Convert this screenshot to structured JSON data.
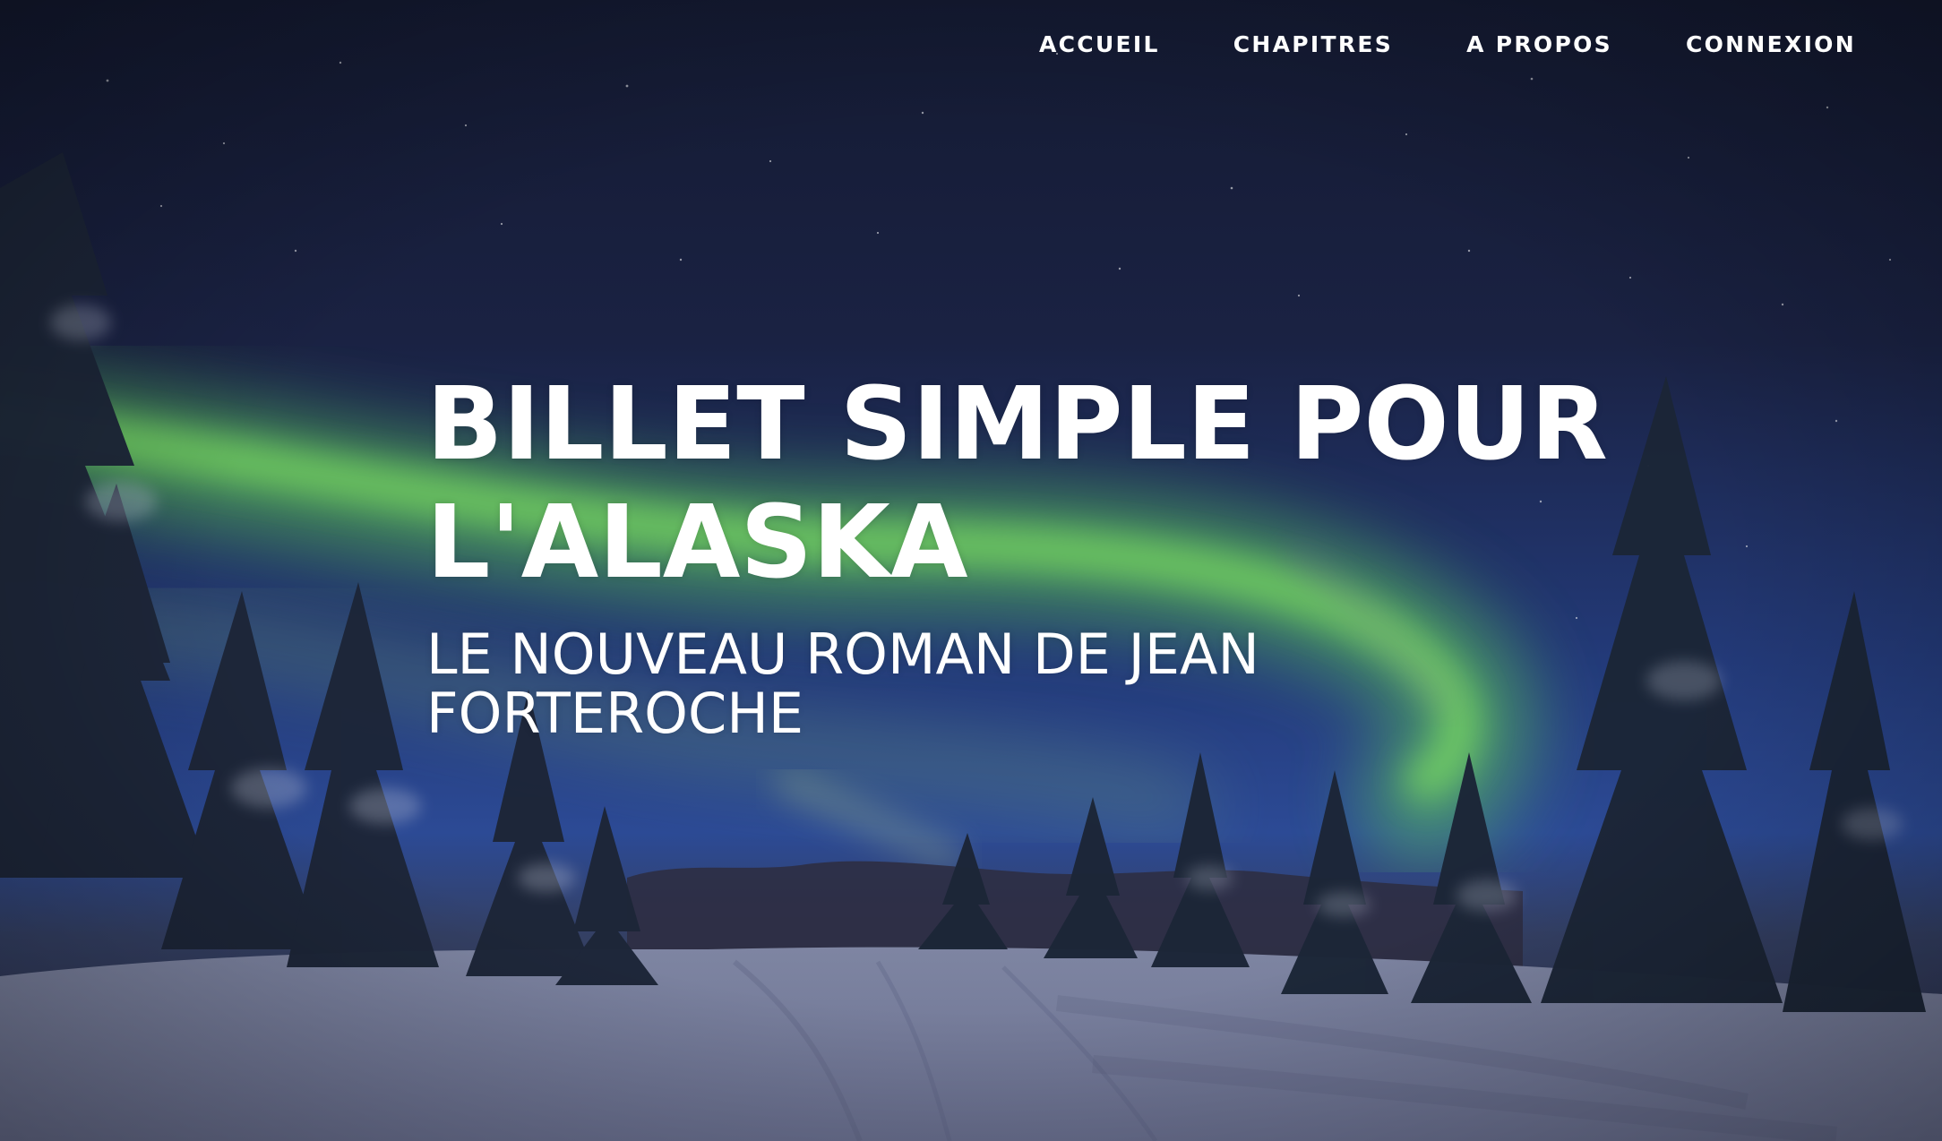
{
  "nav": {
    "items": [
      {
        "label": "ACCUEIL"
      },
      {
        "label": "CHAPITRES"
      },
      {
        "label": "A PROPOS"
      },
      {
        "label": "CONNEXION"
      }
    ]
  },
  "hero": {
    "title_lines": [
      "BILLET SIMPLE POUR",
      "L'ALASKA"
    ],
    "subtitle_lines": [
      "LE NOUVEAU ROMAN DE JEAN",
      "FORTEROCHE"
    ],
    "background_image": "aurora-borealis-snowy-forest-night"
  },
  "colors": {
    "text": "#ffffff",
    "sky_top": "#161c33",
    "sky_mid": "#1c2f63",
    "aurora": "#7fe36a",
    "snow": "#8f96b4",
    "trees": "#243044"
  }
}
